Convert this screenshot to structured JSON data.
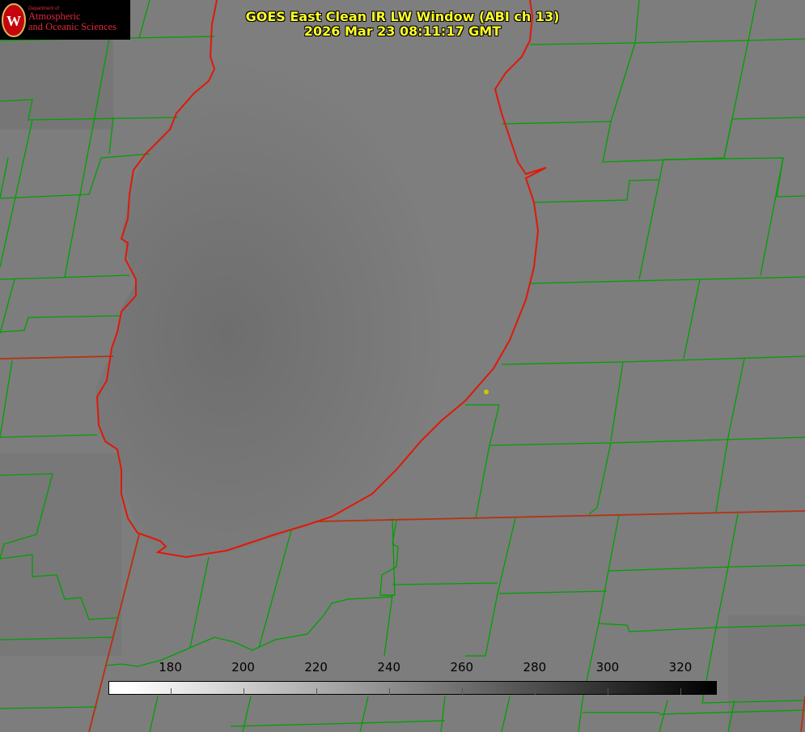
{
  "title": {
    "line1": "GOES East Clean IR LW Window (ABI ch 13)",
    "line2": "2026 Mar 23 08:11:17 GMT"
  },
  "logo": {
    "department": "Department of",
    "name_line1": "Atmospheric",
    "name_line2": "and Oceanic Sciences",
    "icon": "uw-crest-icon"
  },
  "colorbar": {
    "ticks": [
      "180",
      "200",
      "220",
      "240",
      "260",
      "280",
      "300",
      "320"
    ],
    "min_value": 163,
    "max_value": 330
  },
  "colors": {
    "state_border": "#e02010",
    "county_lines": "#00aa00",
    "title_text": "#ffff28",
    "marker": "#c8c800"
  }
}
